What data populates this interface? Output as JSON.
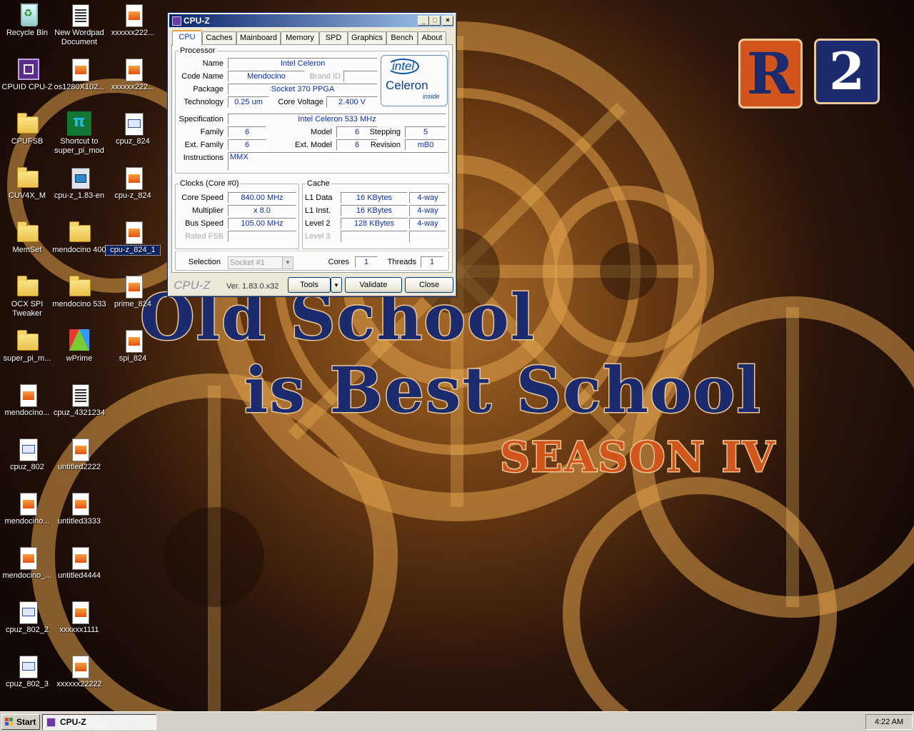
{
  "desktop": {
    "icons": [
      {
        "label": "Recycle Bin",
        "icon": "recycle-bin-icon"
      },
      {
        "label": "New Wordpad Document",
        "icon": "wordpad-document-icon"
      },
      {
        "label": "xxxxxx222...",
        "icon": "image-file-icon"
      },
      {
        "label": "CPUID CPU-Z",
        "icon": "cpu-z-icon"
      },
      {
        "label": "os1280X102...",
        "icon": "image-file-icon"
      },
      {
        "label": "xxxxxx222...",
        "icon": "image-file-icon"
      },
      {
        "label": "CPUFSB",
        "icon": "folder-icon"
      },
      {
        "label": "Shortcut to super_pi_mod",
        "icon": "super-pi-icon"
      },
      {
        "label": "cpuz_824",
        "icon": "bitmap-file-icon"
      },
      {
        "label": "CUV4X_M",
        "icon": "folder-icon"
      },
      {
        "label": "cpu-z_1.83-en",
        "icon": "setup-icon"
      },
      {
        "label": "cpu-z_824",
        "icon": "image-file-icon"
      },
      {
        "label": "MemSet",
        "icon": "folder-icon"
      },
      {
        "label": "mendocino 400",
        "icon": "folder-icon"
      },
      {
        "label": "cpu-z_824_1",
        "icon": "image-file-icon"
      },
      {
        "label": "OCX SPI Tweaker",
        "icon": "folder-icon"
      },
      {
        "label": "mendocino 533",
        "icon": "folder-icon"
      },
      {
        "label": "prime_824",
        "icon": "image-file-icon"
      },
      {
        "label": "super_pi_m...",
        "icon": "folder-icon"
      },
      {
        "label": "wPrime",
        "icon": "wprime-icon"
      },
      {
        "label": "spi_824",
        "icon": "image-file-icon"
      },
      {
        "label": "mendocino...",
        "icon": "image-file-icon"
      },
      {
        "label": "cpuz_4321234",
        "icon": "document-icon"
      },
      {
        "label": "cpuz_802",
        "icon": "bitmap-file-icon"
      },
      {
        "label": "untitled2222",
        "icon": "image-file-icon"
      },
      {
        "label": "mendocino...",
        "icon": "image-file-icon"
      },
      {
        "label": "untitled3333",
        "icon": "image-file-icon"
      },
      {
        "label": "mendocino_...",
        "icon": "image-file-icon"
      },
      {
        "label": "untitled4444",
        "icon": "image-file-icon"
      },
      {
        "label": "cpuz_802_2",
        "icon": "bitmap-file-icon"
      },
      {
        "label": "xxxxxx1111",
        "icon": "image-file-icon"
      },
      {
        "label": "cpuz_802_3",
        "icon": "bitmap-file-icon"
      },
      {
        "label": "xxxxxx22222",
        "icon": "image-file-icon"
      }
    ]
  },
  "wallpaper": {
    "logo_r": "R",
    "logo_2": "2",
    "line1": "Old School",
    "line2": "is Best School",
    "line3": "SEASON IV",
    "colors": {
      "blue": "#1c2a6e",
      "orange": "#d2561c"
    }
  },
  "window": {
    "title": "CPU-Z",
    "tabs": [
      "CPU",
      "Caches",
      "Mainboard",
      "Memory",
      "SPD",
      "Graphics",
      "Bench",
      "About"
    ],
    "active_tab": "CPU",
    "processor": {
      "legend": "Processor",
      "name_label": "Name",
      "name": "Intel Celeron",
      "codename_label": "Code Name",
      "codename": "Mendocino",
      "brandid_label": "Brand ID",
      "brandid": "",
      "package_label": "Package",
      "package": "Socket 370 PPGA",
      "technology_label": "Technology",
      "technology": "0.25 um",
      "voltage_label": "Core Voltage",
      "voltage": "2.400 V",
      "spec_label": "Specification",
      "spec": "Intel Celeron 533 MHz",
      "family_label": "Family",
      "family": "6",
      "model_label": "Model",
      "model": "6",
      "stepping_label": "Stepping",
      "stepping": "5",
      "extfamily_label": "Ext. Family",
      "extfamily": "6",
      "extmodel_label": "Ext. Model",
      "extmodel": "6",
      "revision_label": "Revision",
      "revision": "mB0",
      "instructions_label": "Instructions",
      "instructions": "MMX",
      "brand_logo": {
        "intel": "intel",
        "celeron": "Celeron",
        "inside": "inside"
      }
    },
    "clocks": {
      "legend": "Clocks (Core #0)",
      "core_speed_label": "Core Speed",
      "core_speed": "840.00 MHz",
      "multiplier_label": "Multiplier",
      "multiplier": "x 8.0",
      "bus_speed_label": "Bus Speed",
      "bus_speed": "105.00 MHz",
      "rated_fsb_label": "Rated FSB",
      "rated_fsb": ""
    },
    "cache": {
      "legend": "Cache",
      "l1d_label": "L1 Data",
      "l1d": "16 KBytes",
      "l1d_way": "4-way",
      "l1i_label": "L1 Inst.",
      "l1i": "16 KBytes",
      "l1i_way": "4-way",
      "l2_label": "Level 2",
      "l2": "128 KBytes",
      "l2_way": "4-way",
      "l3_label": "Level 3",
      "l3": "",
      "l3_way": ""
    },
    "selection": {
      "label": "Selection",
      "value": "Socket #1",
      "cores_label": "Cores",
      "cores": "1",
      "threads_label": "Threads",
      "threads": "1"
    },
    "footer": {
      "logo": "CPU-Z",
      "version": "Ver. 1.83.0.x32",
      "tools": "Tools",
      "validate": "Validate",
      "close": "Close"
    }
  },
  "taskbar": {
    "start": "Start",
    "task_label": "CPU-Z",
    "clock": "4:22 AM"
  }
}
